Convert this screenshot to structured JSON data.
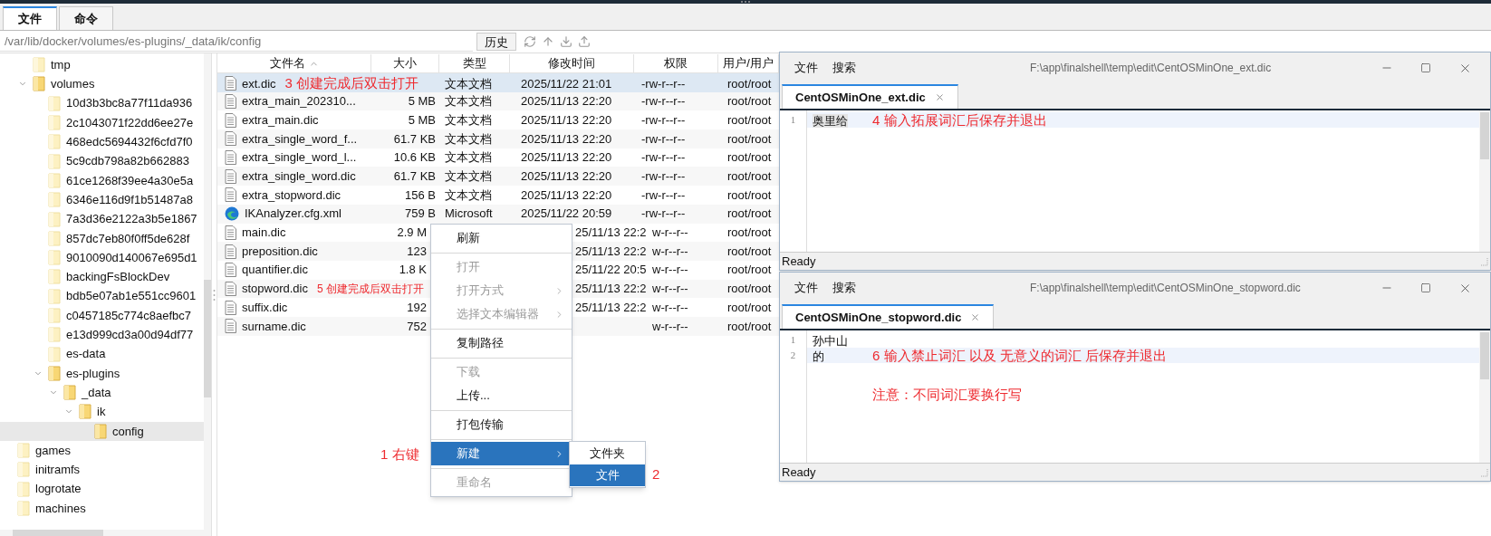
{
  "app_tabs": [
    {
      "label": "文件",
      "selected": true
    },
    {
      "label": "命令",
      "selected": false
    }
  ],
  "path_bar": {
    "value": "/var/lib/docker/volumes/es-plugins/_data/ik/config",
    "history_button": "历史"
  },
  "tree": {
    "scrolled_parent_children": [
      {
        "label": "tmp",
        "expanded": false,
        "selected": false
      },
      {
        "label": "volumes",
        "expanded": true,
        "selected": false,
        "children": [
          {
            "label": "10d3b3bc8a77f11da936",
            "expanded": false,
            "selected": false
          },
          {
            "label": "2c1043071f22dd6ee27e",
            "expanded": false,
            "selected": false
          },
          {
            "label": "468edc5694432f6cfd7f0",
            "expanded": false,
            "selected": false
          },
          {
            "label": "5c9cdb798a82b662883",
            "expanded": false,
            "selected": false
          },
          {
            "label": "61ce1268f39ee4a30e5a",
            "expanded": false,
            "selected": false
          },
          {
            "label": "6346e116d9f1b51487a8",
            "expanded": false,
            "selected": false
          },
          {
            "label": "7a3d36e2122a3b5e1867",
            "expanded": false,
            "selected": false
          },
          {
            "label": "857dc7eb80f0ff5de628f",
            "expanded": false,
            "selected": false
          },
          {
            "label": "9010090d140067e695d1",
            "expanded": false,
            "selected": false
          },
          {
            "label": "backingFsBlockDev",
            "expanded": false,
            "selected": false
          },
          {
            "label": "bdb5e07ab1e551cc9601",
            "expanded": false,
            "selected": false
          },
          {
            "label": "c0457185c774c8aefbc7",
            "expanded": false,
            "selected": false
          },
          {
            "label": "e13d999cd3a00d94df77",
            "expanded": false,
            "selected": false
          },
          {
            "label": "es-data",
            "expanded": false,
            "selected": false
          },
          {
            "label": "es-plugins",
            "expanded": true,
            "selected": false,
            "children": [
              {
                "label": "_data",
                "expanded": true,
                "selected": false,
                "children": [
                  {
                    "label": "ik",
                    "expanded": true,
                    "selected": false,
                    "children": [
                      {
                        "label": "config",
                        "expanded": false,
                        "selected": true
                      }
                    ]
                  }
                ]
              }
            ]
          }
        ]
      }
    ],
    "items": [
      {
        "label": "games",
        "expanded": false,
        "selected": false
      },
      {
        "label": "initramfs",
        "expanded": false,
        "selected": false
      },
      {
        "label": "logrotate",
        "expanded": false,
        "selected": false
      },
      {
        "label": "machines",
        "expanded": false,
        "selected": false
      }
    ]
  },
  "file_table": {
    "columns": [
      {
        "label": "文件名",
        "sorted": true
      },
      {
        "label": "大小",
        "sorted": false
      },
      {
        "label": "类型",
        "sorted": false
      },
      {
        "label": "修改时间",
        "sorted": false
      },
      {
        "label": "权限",
        "sorted": false
      },
      {
        "label": "用户/用户",
        "sorted": false
      }
    ],
    "rows": [
      {
        "kind": "document",
        "name": "ext.dic",
        "type": "文本文档",
        "modified": "2025/11/22 21:01",
        "permissions": "-rw-r--r--",
        "owner": "root/root",
        "selected": true,
        "annotation": "3 创建完成后双击打开"
      },
      {
        "kind": "document",
        "name": "extra_main_202310...",
        "size": "5 MB",
        "type": "文本文档",
        "modified": "2025/11/13 22:20",
        "permissions": "-rw-r--r--",
        "owner": "root/root",
        "selected": false
      },
      {
        "kind": "document",
        "name": "extra_main.dic",
        "size": "5 MB",
        "type": "文本文档",
        "modified": "2025/11/13 22:20",
        "permissions": "-rw-r--r--",
        "owner": "root/root",
        "selected": false
      },
      {
        "kind": "document",
        "name": "extra_single_word_f...",
        "size": "61.7 KB",
        "type": "文本文档",
        "modified": "2025/11/13 22:20",
        "permissions": "-rw-r--r--",
        "owner": "root/root",
        "selected": false
      },
      {
        "kind": "document",
        "name": "extra_single_word_l...",
        "size": "10.6 KB",
        "type": "文本文档",
        "modified": "2025/11/13 22:20",
        "permissions": "-rw-r--r--",
        "owner": "root/root",
        "selected": false
      },
      {
        "kind": "document",
        "name": "extra_single_word.dic",
        "size": "61.7 KB",
        "type": "文本文档",
        "modified": "2025/11/13 22:20",
        "permissions": "-rw-r--r--",
        "owner": "root/root",
        "selected": false
      },
      {
        "kind": "document",
        "name": "extra_stopword.dic",
        "size": "156 B",
        "type": "文本文档",
        "modified": "2025/11/13 22:20",
        "permissions": "-rw-r--r--",
        "owner": "root/root",
        "selected": false
      },
      {
        "kind": "web",
        "name": "IKAnalyzer.cfg.xml",
        "size": "759 B",
        "type": "Microsoft",
        "modified": "2025/11/22 20:59",
        "permissions": "-rw-r--r--",
        "owner": "root/root",
        "selected": false
      },
      {
        "kind": "document",
        "name": "main.dic",
        "size": "2.9 M",
        "modified": "25/11/13 22:2",
        "permissions": "w-r--r--",
        "owner": "root/root",
        "selected": false
      },
      {
        "kind": "document",
        "name": "preposition.dic",
        "size": "123",
        "modified": "25/11/13 22:2",
        "permissions": "w-r--r--",
        "owner": "root/root",
        "selected": false
      },
      {
        "kind": "document",
        "name": "quantifier.dic",
        "size": "1.8 K",
        "modified": "25/11/22 20:5",
        "permissions": "w-r--r--",
        "owner": "root/root",
        "selected": false
      },
      {
        "kind": "document",
        "name": "stopword.dic",
        "modified": "25/11/13 22:2",
        "permissions": "w-r--r--",
        "owner": "root/root",
        "selected": false,
        "annotation": "5 创建完成后双击打开"
      },
      {
        "kind": "document",
        "name": "suffix.dic",
        "size": "192",
        "modified": "25/11/13 22:2",
        "permissions": "w-r--r--",
        "owner": "root/root",
        "selected": false
      },
      {
        "kind": "document",
        "name": "surname.dic",
        "size": "752",
        "permissions": "w-r--r--",
        "owner": "root/root",
        "selected": false
      }
    ]
  },
  "context_menu": {
    "items": [
      {
        "kind": "item",
        "label": "刷新",
        "disabled": false,
        "submenu": false,
        "selected": false
      },
      {
        "kind": "separator"
      },
      {
        "kind": "item",
        "label": "打开",
        "disabled": true,
        "submenu": false,
        "selected": false
      },
      {
        "kind": "item",
        "label": "打开方式",
        "disabled": true,
        "submenu": true,
        "selected": false
      },
      {
        "kind": "item",
        "label": "选择文本编辑器",
        "disabled": true,
        "submenu": true,
        "selected": false
      },
      {
        "kind": "separator"
      },
      {
        "kind": "item",
        "label": "复制路径",
        "disabled": false,
        "submenu": false,
        "selected": false
      },
      {
        "kind": "separator"
      },
      {
        "kind": "item",
        "label": "下载",
        "disabled": true,
        "submenu": false,
        "selected": false
      },
      {
        "kind": "item",
        "label": "上传...",
        "disabled": false,
        "submenu": false,
        "selected": false
      },
      {
        "kind": "separator"
      },
      {
        "kind": "item",
        "label": "打包传输",
        "disabled": false,
        "submenu": false,
        "selected": false
      },
      {
        "kind": "separator"
      },
      {
        "kind": "item",
        "label": "新建",
        "disabled": false,
        "submenu": true,
        "selected": true
      },
      {
        "kind": "separator"
      },
      {
        "kind": "item",
        "label": "重命名",
        "disabled": true,
        "submenu": false,
        "selected": false
      }
    ],
    "submenu": [
      {
        "label": "文件夹",
        "selected": false
      },
      {
        "label": "文件",
        "selected": true
      }
    ],
    "annotation": "1 右键",
    "submenu_annotation": "2"
  },
  "editors": [
    {
      "menu": [
        "文件",
        "搜索"
      ],
      "title": "F:\\app\\finalshell\\temp\\edit\\CentOSMinOne_ext.dic",
      "tab": "CentOSMinOne_ext.dic",
      "lines": [
        {
          "number": "1",
          "text": "奥里给",
          "current": true
        }
      ],
      "annotations": [
        "4 输入拓展词汇后保存并退出"
      ],
      "status": "Ready"
    },
    {
      "menu": [
        "文件",
        "搜索"
      ],
      "title": "F:\\app\\finalshell\\temp\\edit\\CentOSMinOne_stopword.dic",
      "tab": "CentOSMinOne_stopword.dic",
      "lines": [
        {
          "number": "1",
          "text": "孙中山",
          "current": false
        },
        {
          "number": "2",
          "text": "的",
          "current": true
        }
      ],
      "annotations": [
        "6 输入禁止词汇 以及 无意义的词汇 后保存并退出",
        "注意：不同词汇要换行写"
      ],
      "status": "Ready"
    }
  ]
}
